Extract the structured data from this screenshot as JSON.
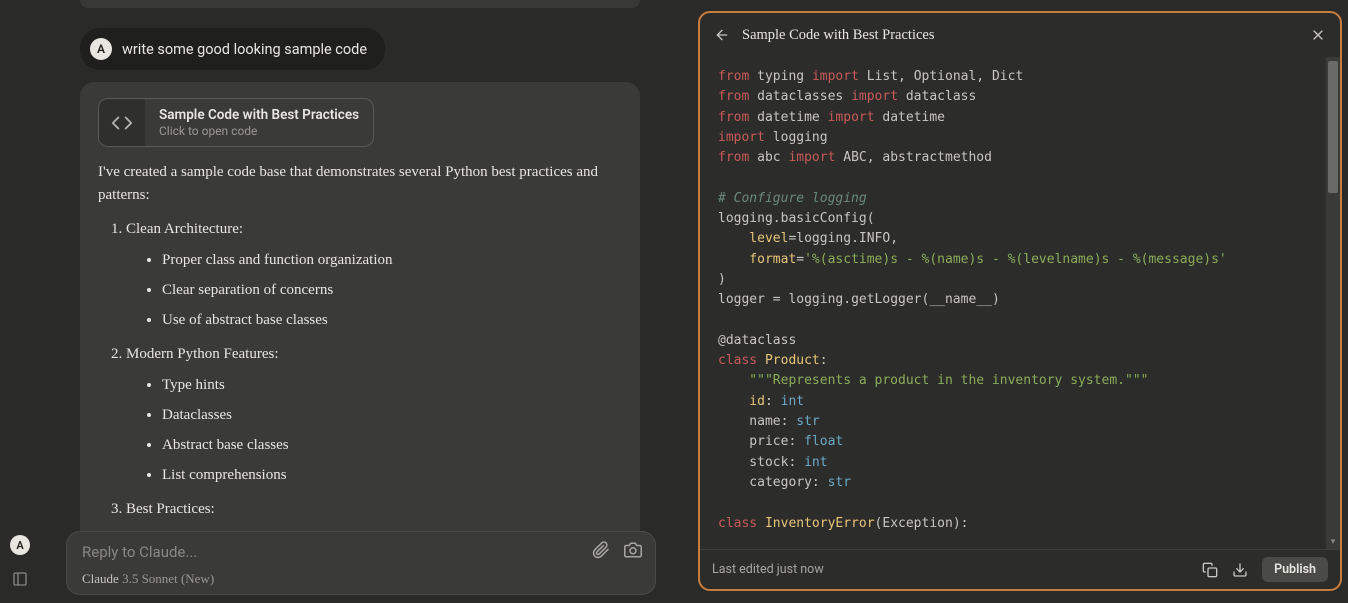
{
  "user": {
    "avatar_letter": "A",
    "message": "write some good looking sample code"
  },
  "assistant": {
    "code_card": {
      "title": "Sample Code with Best Practices",
      "subtitle": "Click to open code"
    },
    "intro": "I've created a sample code base that demonstrates several Python best practices and patterns:",
    "sections": [
      {
        "heading": "Clean Architecture:",
        "items": [
          "Proper class and function organization",
          "Clear separation of concerns",
          "Use of abstract base classes"
        ]
      },
      {
        "heading": "Modern Python Features:",
        "items": [
          "Type hints",
          "Dataclasses",
          "Abstract base classes",
          "List comprehensions"
        ]
      },
      {
        "heading": "Best Practices:",
        "items": []
      }
    ]
  },
  "input": {
    "placeholder": "Reply to Claude...",
    "model_name": "Claude",
    "model_version": "3.5 Sonnet (New)"
  },
  "panel": {
    "title": "Sample Code with Best Practices",
    "footer_text": "Last edited just now",
    "publish_label": "Publish"
  },
  "code": {
    "l1": {
      "a": "from",
      "b": " typing ",
      "c": "import",
      "d": " List, Optional, Dict"
    },
    "l2": {
      "a": "from",
      "b": " dataclasses ",
      "c": "import",
      "d": " dataclass"
    },
    "l3": {
      "a": "from",
      "b": " datetime ",
      "c": "import",
      "d": " datetime"
    },
    "l4": {
      "a": "import",
      "b": " logging"
    },
    "l5": {
      "a": "from",
      "b": " abc ",
      "c": "import",
      "d": " ABC, abstractmethod"
    },
    "l7": "# Configure logging",
    "l8": "logging.basicConfig(",
    "l9a": "    level",
    "l9b": "=",
    "l9c": "logging.INFO,",
    "l10a": "    format",
    "l10b": "=",
    "l10c": "'%(asctime)s - %(name)s - %(levelname)s - %(message)s'",
    "l11": ")",
    "l12a": "logger ",
    "l12b": "=",
    "l12c": " logging.getLogger(__name__)",
    "l14": "@dataclass",
    "l15a": "class",
    "l15b": " ",
    "l15c": "Product",
    "l15d": ":",
    "l16": "    \"\"\"Represents a product in the inventory system.\"\"\"",
    "l17a": "    id",
    "l17b": ": ",
    "l17c": "int",
    "l18a": "    name",
    "l18b": ": ",
    "l18c": "str",
    "l19a": "    price",
    "l19b": ": ",
    "l19c": "float",
    "l20a": "    stock",
    "l20b": ": ",
    "l20c": "int",
    "l21a": "    category",
    "l21b": ": ",
    "l21c": "str",
    "l23a": "class",
    "l23b": " ",
    "l23c": "InventoryError",
    "l23d": "(Exception):"
  }
}
